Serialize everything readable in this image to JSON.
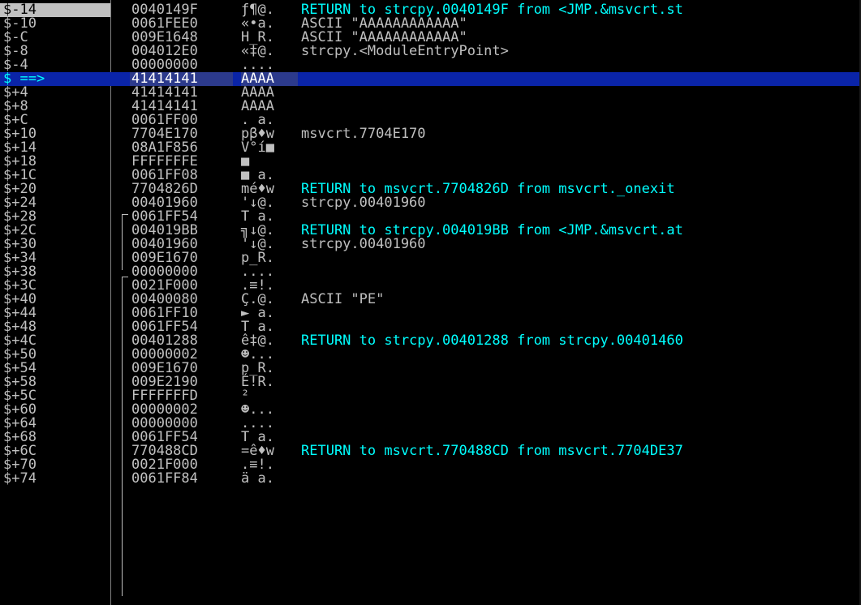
{
  "colors": {
    "background": "#000000",
    "text": "#c0c0c0",
    "return_comment": "#00ffff",
    "selection_bar": "#0a24a8",
    "top_row_highlight": "#c0c0c0"
  },
  "rows": [
    {
      "offset": "$-14",
      "value": "0040149F",
      "ascii": "ƒ¶@.",
      "comment": "RETURN to strcpy.0040149F from <JMP.&msvcrt.st",
      "ret": true
    },
    {
      "offset": "$-10",
      "value": "0061FEE0",
      "ascii": "«•a.",
      "comment": "ASCII \"AAAAAAAAAAAA\"",
      "ret": false
    },
    {
      "offset": "$-C",
      "value": "009E1648",
      "ascii": "H_R.",
      "comment": "ASCII \"AAAAAAAAAAAA\"",
      "ret": false
    },
    {
      "offset": "$-8",
      "value": "004012E0",
      "ascii": "«‡@.",
      "comment": "strcpy.<ModuleEntryPoint>",
      "ret": false
    },
    {
      "offset": "$-4",
      "value": "00000000",
      "ascii": "....",
      "comment": "",
      "ret": false
    },
    {
      "offset": "$ ==>",
      "value": "41414141",
      "ascii": "AAAA",
      "comment": "",
      "ret": false
    },
    {
      "offset": "$+4",
      "value": "41414141",
      "ascii": "AAAA",
      "comment": "",
      "ret": false
    },
    {
      "offset": "$+8",
      "value": "41414141",
      "ascii": "AAAA",
      "comment": "",
      "ret": false
    },
    {
      "offset": "$+C",
      "value": "0061FF00",
      "ascii": ". a.",
      "comment": "",
      "ret": false
    },
    {
      "offset": "$+10",
      "value": "7704E170",
      "ascii": "pβ♦w",
      "comment": "msvcrt.7704E170",
      "ret": false
    },
    {
      "offset": "$+14",
      "value": "08A1F856",
      "ascii": "V°í■",
      "comment": "",
      "ret": false
    },
    {
      "offset": "$+18",
      "value": "FFFFFFFE",
      "ascii": "■",
      "comment": "",
      "ret": false
    },
    {
      "offset": "$+1C",
      "value": "0061FF08",
      "ascii": "■ a.",
      "comment": "",
      "ret": false
    },
    {
      "offset": "$+20",
      "value": "7704826D",
      "ascii": "mé♦w",
      "comment": "RETURN to msvcrt.7704826D from msvcrt._onexit",
      "ret": true
    },
    {
      "offset": "$+24",
      "value": "00401960",
      "ascii": "'↓@.",
      "comment": "strcpy.00401960",
      "ret": false
    },
    {
      "offset": "$+28",
      "value": "0061FF54",
      "ascii": "T a.",
      "comment": "",
      "ret": false
    },
    {
      "offset": "$+2C",
      "value": "004019BB",
      "ascii": "╗↓@.",
      "comment": "RETURN to strcpy.004019BB from <JMP.&msvcrt.at",
      "ret": true
    },
    {
      "offset": "$+30",
      "value": "00401960",
      "ascii": "'↓@.",
      "comment": "strcpy.00401960",
      "ret": false
    },
    {
      "offset": "$+34",
      "value": "009E1670",
      "ascii": "p_R.",
      "comment": "",
      "ret": false
    },
    {
      "offset": "$+38",
      "value": "00000000",
      "ascii": "....",
      "comment": "",
      "ret": false
    },
    {
      "offset": "$+3C",
      "value": "0021F000",
      "ascii": ".≡!.",
      "comment": "",
      "ret": false
    },
    {
      "offset": "$+40",
      "value": "00400080",
      "ascii": "Ç.@.",
      "comment": "ASCII \"PE\"",
      "ret": false
    },
    {
      "offset": "$+44",
      "value": "0061FF10",
      "ascii": "► a.",
      "comment": "",
      "ret": false
    },
    {
      "offset": "$+48",
      "value": "0061FF54",
      "ascii": "T a.",
      "comment": "",
      "ret": false
    },
    {
      "offset": "$+4C",
      "value": "00401288",
      "ascii": "ê‡@.",
      "comment": "RETURN to strcpy.00401288 from strcpy.00401460",
      "ret": true
    },
    {
      "offset": "$+50",
      "value": "00000002",
      "ascii": "☻...",
      "comment": "",
      "ret": false
    },
    {
      "offset": "$+54",
      "value": "009E1670",
      "ascii": "p_R.",
      "comment": "",
      "ret": false
    },
    {
      "offset": "$+58",
      "value": "009E2190",
      "ascii": "É!R.",
      "comment": "",
      "ret": false
    },
    {
      "offset": "$+5C",
      "value": "FFFFFFFD",
      "ascii": "²",
      "comment": "",
      "ret": false
    },
    {
      "offset": "$+60",
      "value": "00000002",
      "ascii": "☻...",
      "comment": "",
      "ret": false
    },
    {
      "offset": "$+64",
      "value": "00000000",
      "ascii": "....",
      "comment": "",
      "ret": false
    },
    {
      "offset": "$+68",
      "value": "0061FF54",
      "ascii": "T a.",
      "comment": "",
      "ret": false
    },
    {
      "offset": "$+6C",
      "value": "770488CD",
      "ascii": "=ê♦w",
      "comment": "RETURN to msvcrt.770488CD from msvcrt.7704DE37",
      "ret": true
    },
    {
      "offset": "$+70",
      "value": "0021F000",
      "ascii": ".≡!.",
      "comment": "",
      "ret": false
    },
    {
      "offset": "$+74",
      "value": "0061FF84",
      "ascii": "ä a.",
      "comment": "",
      "ret": false
    }
  ]
}
